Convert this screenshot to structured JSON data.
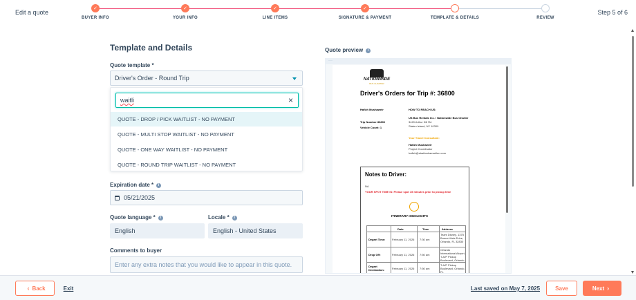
{
  "header": {
    "edit_label": "Edit a quote",
    "step_label": "Step 5 of 6",
    "steps": [
      {
        "label": "BUYER INFO",
        "state": "done"
      },
      {
        "label": "YOUR INFO",
        "state": "done"
      },
      {
        "label": "LINE ITEMS",
        "state": "done"
      },
      {
        "label": "SIGNATURE & PAYMENT",
        "state": "done"
      },
      {
        "label": "TEMPLATE & DETAILS",
        "state": "current"
      },
      {
        "label": "REVIEW",
        "state": "todo"
      }
    ]
  },
  "form": {
    "section_title": "Template and Details",
    "template_label": "Quote template *",
    "template_value": "Driver's Order - Round Trip",
    "search_value": "waitli",
    "options": [
      "QUOTE - DROP / PICK WAITLIST - NO PAYMENT",
      "QUOTE - MULTI STOP WAITLIST - NO PAYMENT",
      "QUOTE - ONE WAY WAITLIST - NO PAYMENT",
      "QUOTE - ROUND TRIP WAITLIST - NO PAYMENT"
    ],
    "expiration_label": "Expiration date *",
    "expiration_value": "05/21/2025",
    "language_label": "Quote language *",
    "language_value": "English",
    "locale_label": "Locale *",
    "locale_value": "English - United States",
    "comments_label": "Comments to buyer",
    "comments_placeholder": "Enter any extra notes that you would like to appear in this quote."
  },
  "preview": {
    "label": "Quote preview",
    "logo_text": "NATIONWIDE",
    "logo_sub": "BUS CHARTER",
    "doc_title": "Driver's Orders for Trip #: 36800",
    "left_block": [
      "Hafizh Mushaweir",
      "",
      "Trip Number:36800",
      "Vehicle Count: 1"
    ],
    "reach_title": "HOW TO REACH US:",
    "reach_lines": [
      "US Bus Rentals Inc. / Nationwide Bus Charter",
      "3420 Arthur Kill Rd",
      "Staten Island, NY 10309"
    ],
    "consultant_title": "Your Travel Consultant:",
    "consultant_lines": [
      "Hafizh Mushaweir",
      "Project Coordinator",
      "hafizh@strattonkamahlen.com"
    ],
    "notes_title": "Notes to Driver:",
    "notes_na": "NA",
    "notes_red": "YOUR SPOT TIME IS: Please spot 15 minutes prior to pickup time",
    "itinerary_title": "ITINERARY HIGHLIGHTS",
    "grid_head": [
      "Date",
      "Time",
      "Address"
    ],
    "grid_rows": [
      {
        "label": "Depart Time:",
        "date": "February 11, 2026",
        "time": "7:30 am",
        "addr": "Team Disney, 1375 Buena Vista Drive, Orlando, FL 32830"
      },
      {
        "label": "Drop Off:",
        "date": "February 11, 2026",
        "time": "7:50 am",
        "addr": "Orlando International Airport, T-A/P Pickup Boulevard, Orlando, FL 32827"
      },
      {
        "label": "Depart Destination:",
        "date": "February 11, 2026",
        "time": "7:50 am",
        "addr": "T-A/P Pickup Boulevard, Orlando, FL"
      }
    ]
  },
  "footer": {
    "back_label": "Back",
    "exit_label": "Exit",
    "saved_label": "Last saved on May 7, 2025",
    "save_label": "Save",
    "next_label": "Next"
  },
  "colors": {
    "accent": "#ff7a59",
    "progress_line": "#f2547d",
    "highlight": "#e5f5f8",
    "focus": "#00bda5"
  }
}
